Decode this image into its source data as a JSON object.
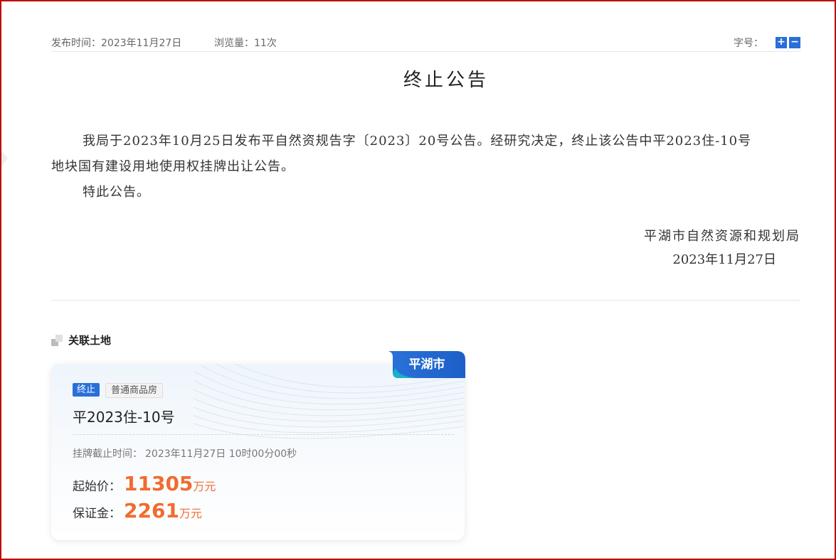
{
  "meta": {
    "publish_time": "发布时间：2023年11月27日",
    "views": "浏览量：11次",
    "font_size_label": "字号：",
    "font_plus": "+",
    "font_minus": "−"
  },
  "notice": {
    "title": "终止公告",
    "paragraph1_line1": "我局于2023年10月25日发布平自然资规告字〔2023〕20号公告。经研究决定，终止该公告中平2023住-10号",
    "paragraph1_line2": "地块国有建设用地使用权挂牌出让公告。",
    "paragraph2": "特此公告。",
    "signature_org": "平湖市自然资源和规划局",
    "signature_date": "2023年11月27日"
  },
  "related": {
    "heading": "关联土地",
    "card": {
      "city": "平湖市",
      "status_badge": "终止",
      "type_badge": "普通商品房",
      "parcel_name": "平2023住-10号",
      "deadline_label": "挂牌截止时间：",
      "deadline_value": "2023年11月27日 10时00分00秒",
      "start_price_label": "起始价：",
      "start_price_value": "11305",
      "start_price_unit": "万元",
      "deposit_label": "保证金：",
      "deposit_value": "2261",
      "deposit_unit": "万元"
    }
  },
  "colors": {
    "frame_border": "#c00000",
    "accent_blue": "#2a6fd8",
    "price_orange": "#f26b2f"
  },
  "icons": {
    "font_increase": "plus-icon",
    "font_decrease": "minus-icon",
    "section_marker": "square-bullet-icon"
  }
}
